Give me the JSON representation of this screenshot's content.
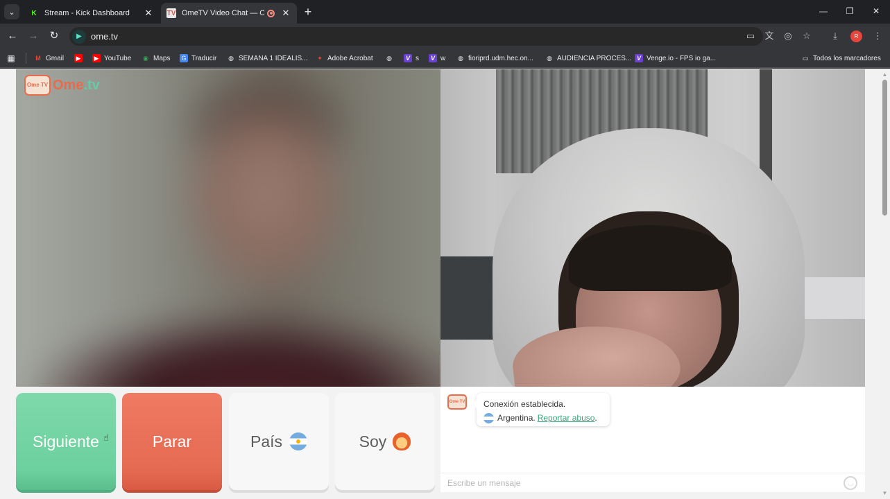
{
  "tabs": [
    {
      "title": "Stream - Kick Dashboard",
      "icon": "kick-icon"
    },
    {
      "title": "OmeTV Video Chat — Ome",
      "icon": "ometv-icon"
    }
  ],
  "address_bar": {
    "url": "ome.tv"
  },
  "profile_initial": "R",
  "bookmarks": [
    {
      "label": "Gmail",
      "glyph": "M"
    },
    {
      "label": "",
      "glyph": "▶"
    },
    {
      "label": "YouTube",
      "glyph": "▶"
    },
    {
      "label": "Maps",
      "glyph": "◉"
    },
    {
      "label": "Traducir",
      "glyph": "G"
    },
    {
      "label": "SEMANA 1 IDEALIS...",
      "glyph": "◍"
    },
    {
      "label": "Adobe Acrobat",
      "glyph": "✦"
    },
    {
      "label": "",
      "glyph": "◍"
    },
    {
      "label": "s",
      "glyph": "V"
    },
    {
      "label": "w",
      "glyph": "V"
    },
    {
      "label": "fioriprd.udm.hec.on...",
      "glyph": "◍"
    },
    {
      "label": "AUDIENCIA PROCES...",
      "glyph": "◍"
    },
    {
      "label": "Venge.io - FPS io ga...",
      "glyph": "V"
    }
  ],
  "all_bookmarks_label": "Todos los marcadores",
  "logo": {
    "icon_text": "Ome TV",
    "word_a": "Ome",
    "word_b": ".tv"
  },
  "controls": {
    "next_label": "Siguiente",
    "stop_label": "Parar",
    "country_label": "País",
    "gender_label": "Soy"
  },
  "chat": {
    "avatar_text": "Ome TV",
    "status_line": "Conexión establecida.",
    "country": "Argentina.",
    "report_link": "Reportar abuso",
    "report_suffix": ".",
    "input_placeholder": "Escribe un mensaje"
  }
}
